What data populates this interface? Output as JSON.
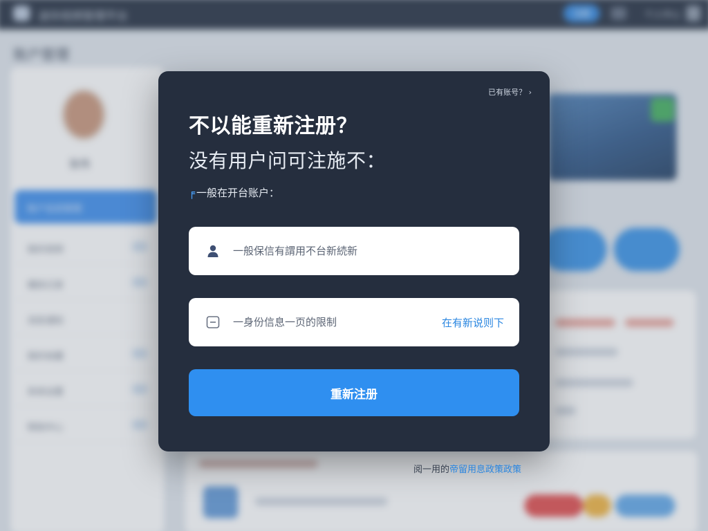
{
  "background": {
    "app_title": "迷你视频管理平台",
    "top_pill": "注册",
    "user_menu": "个人中心",
    "page_title": "账户管理",
    "user_name": "张伟",
    "nav_items": [
      {
        "label": "账户信息管理"
      },
      {
        "label": "我的视频"
      },
      {
        "label": "播放记录"
      },
      {
        "label": "消息通知"
      },
      {
        "label": "我的收藏"
      },
      {
        "label": "系统设置"
      },
      {
        "label": "帮助中心"
      }
    ]
  },
  "modal": {
    "corner_link": "已有账号？",
    "title": "不以能重新注册？",
    "subtitle": "没有用户问可注施不：",
    "note_marker": "╒",
    "note": "一般在开台账户：",
    "fields": [
      {
        "icon": "user-icon",
        "placeholder": "一般保信有謂用不台新続新",
        "value": ""
      },
      {
        "icon": "id-card-icon",
        "placeholder": "一身份信息一页的限制",
        "value": "",
        "link": "在有新说则下"
      }
    ],
    "submit_label": "重新注册"
  },
  "footer": {
    "prefix": "阅一用的",
    "link": "帝留用息政策政策"
  },
  "colors": {
    "modal_bg": "#252e3e",
    "accent": "#2f8ff0",
    "link": "#2a86e0",
    "topbar": "#1f2a3c"
  }
}
